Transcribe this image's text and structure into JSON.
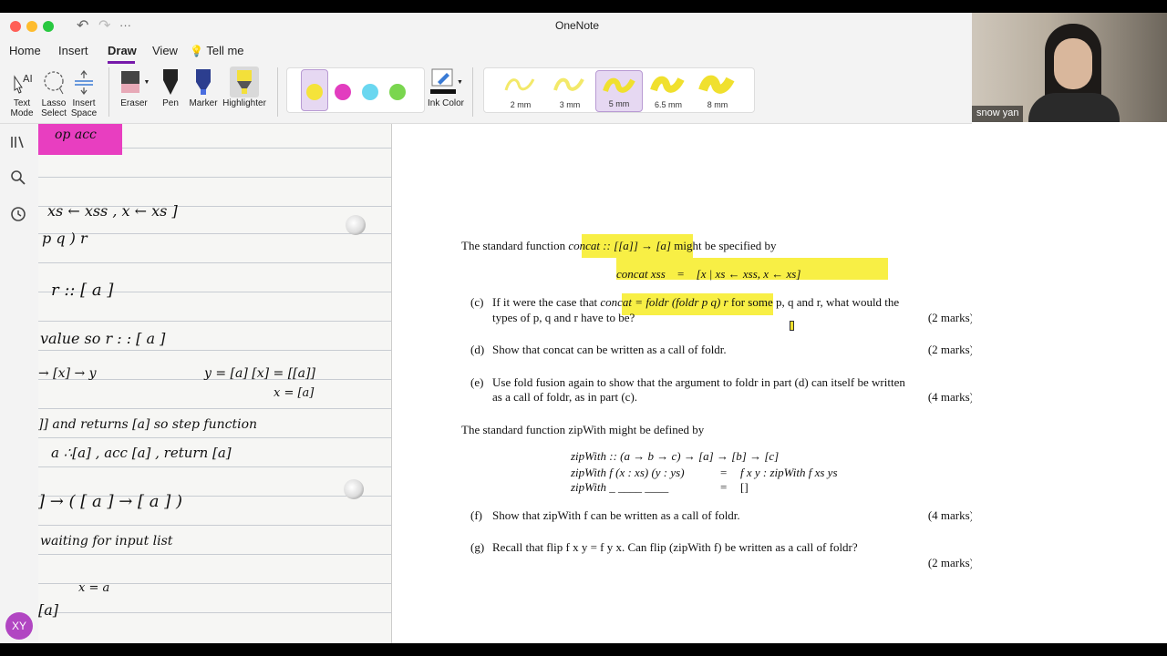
{
  "window": {
    "app_title": "OneNote"
  },
  "titlebar": {
    "undo_icon": "undo-icon",
    "redo_icon": "redo-icon",
    "more_icon": "more-icon",
    "more_glyph": "···"
  },
  "tabs": [
    {
      "label": "Home"
    },
    {
      "label": "Insert"
    },
    {
      "label": "Draw",
      "active": true
    },
    {
      "label": "View"
    },
    {
      "label": "Tell me"
    }
  ],
  "ribbon": {
    "text_mode": "Text Mode",
    "lasso_select": "Lasso Select",
    "insert_space": "Insert Space",
    "eraser": "Eraser",
    "pen": "Pen",
    "marker": "Marker",
    "highlighter": "Highlighter",
    "ink_color": "Ink Color",
    "pen_swatches": [
      "#f5e33a",
      "#e23dbf",
      "#6ad7f0",
      "#7ad64f"
    ],
    "thicknesses": [
      "2 mm",
      "3 mm",
      "5 mm",
      "6.5 mm",
      "8 mm"
    ],
    "selected_thickness": "5 mm",
    "accent": "#7719aa"
  },
  "nav": {
    "avatar_initials": "XY"
  },
  "notebook": {
    "lines": [
      "op  acc",
      "xs ← xss , x ← xs ]",
      "p  q )  r",
      "r   ::  [ a ]",
      "value  so   r : : [ a ]",
      "→ [x] → y",
      "y = [a]   [x] = [[a]]",
      "x = [a]",
      "]] and returns  [a]   so  step function",
      "a ∴[a] ,  acc  [a] ,  return  [a]",
      "] → ( [ a ] → [ a ] )",
      "waiting  for  input list",
      "x = a",
      "[a]"
    ]
  },
  "paper": {
    "intro1": "The standard function",
    "concat_sig": "concat :: [[a]] → [a]",
    "intro1_tail": "might be specified by",
    "concat_def_lhs": "concat xss",
    "concat_def_eq": "=",
    "concat_def_rhs": "[x | xs ← xss, x ← xs]",
    "c_label": "(c)",
    "c_text1": "If it were the case that",
    "c_expr": "concat = foldr (foldr p q) r",
    "c_text2": "for some p, q and r, what would the",
    "c_text3": "types of p, q and r have to be?",
    "c_marks": "(2 marks)",
    "d_label": "(d)",
    "d_text": "Show that concat can be written as a call of foldr.",
    "d_marks": "(2 marks)",
    "e_label": "(e)",
    "e_text1": "Use fold fusion again to show that the argument to foldr in part (d) can itself be written",
    "e_text2": "as a call of foldr, as in part (c).",
    "e_marks": "(4 marks)",
    "intro2": "The standard function zipWith might be defined by",
    "zw1": "zipWith :: (a → b → c) → [a] → [b] → [c]",
    "zw2_lhs": "zipWith f (x : xs) (y : ys)",
    "zw2_eq": "=",
    "zw2_rhs": "f x y : zipWith f xs ys",
    "zw3_lhs": "zipWith _  ____  ____",
    "zw3_eq": "=",
    "zw3_rhs": "[]",
    "f_label": "(f)",
    "f_text": "Show that zipWith f can be written as a call of foldr.",
    "f_marks": "(4 marks)",
    "g_label": "(g)",
    "g_text": "Recall that flip f x y = f y x.  Can flip (zipWith f) be written as a call of foldr?",
    "g_marks": "(2 marks)",
    "highlight_color": "#f8ef45"
  },
  "video": {
    "participant_name": "snow yan"
  }
}
